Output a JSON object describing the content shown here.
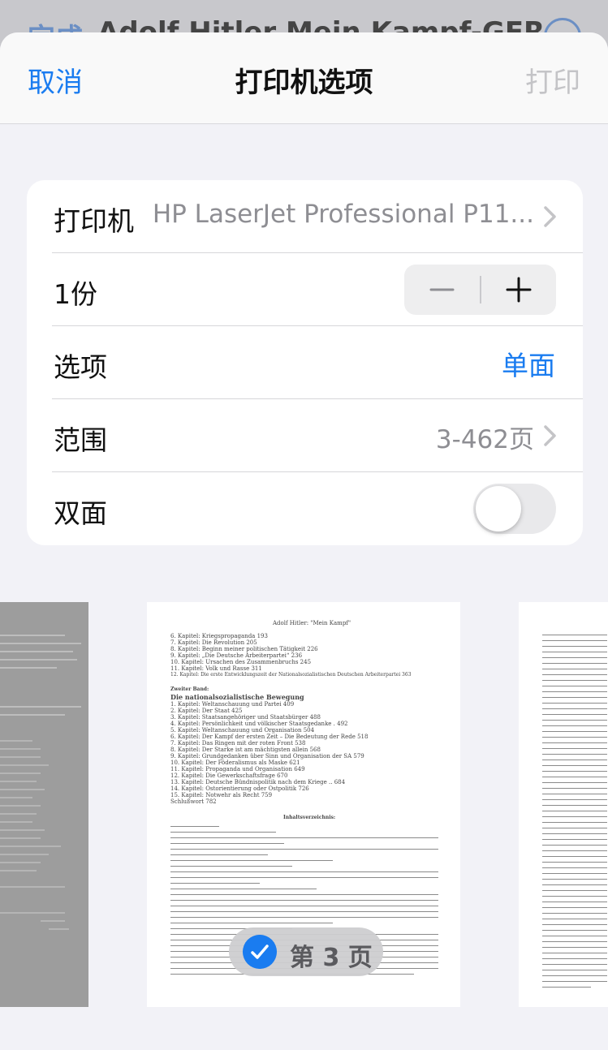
{
  "background": {
    "left_button": "完成",
    "title": "Adolf Hitler Mein Kampf-GER"
  },
  "navbar": {
    "cancel_label": "取消",
    "title": "打印机选项",
    "print_label": "打印"
  },
  "options": {
    "printer": {
      "label": "打印机",
      "value": "HP LaserJet Professional P11..."
    },
    "copies": {
      "label": "1份"
    },
    "options_row": {
      "label": "选项",
      "value": "单面"
    },
    "range": {
      "label": "范围",
      "value": "3-462页"
    },
    "duplex": {
      "label": "双面",
      "on": false
    }
  },
  "preview": {
    "page_label": "第 3 页",
    "main_page": {
      "header": "Adolf Hitler: \"Mein Kampf\"",
      "chapters_1": [
        "6. Kapitel: Kriegspropaganda 193",
        "7. Kapitel: Die Revolution 205",
        "8. Kapitel: Beginn meiner politischen Tätigkeit 226",
        "9. Kapitel: „Die Deutsche Arbeiterpartei“ 236",
        "10. Kapitel: Ursachen des Zusammenbruchs 245",
        "11. Kapitel: Volk und Rasse 311",
        "12. Kapitel: Die erste Entwicklungszeit der Nationalsozialistischen Deutschen Arbeiterpartei 363"
      ],
      "volume_label": "Zweiter Band:",
      "volume_title": "Die nationalsozialistische Bewegung",
      "chapters_2": [
        "1. Kapitel: Weltanschauung und Partei 409",
        "2. Kapitel: Der Staat 425",
        "3. Kapitel: Staatsangehöriger und Staatsbürger 488",
        "4. Kapitel: Persönlichkeit und völkischer Staatsgedanke . 492",
        "5. Kapitel: Weltanschauung und Organisation 504",
        "6. Kapitel: Der Kampf der ersten Zeit – Die Bedeutung der Rede 518",
        "7. Kapitel: Das Ringen mit der roten Front 538",
        "8. Kapitel: Der Starke ist am mächtigsten allein 568",
        "9. Kapitel: Grundgedanken über Sinn und Organisation der SA 579",
        "10. Kapitel: Der Föderalismus als Maske 621",
        "11. Kapitel: Propaganda und Organisation 649",
        "12. Kapitel: Die Gewerkschaftsfrage 670",
        "13. Kapitel: Deutsche Bündnispolitik nach dem Kriege .. 684",
        "14. Kapitel: Ostorientierung oder Ostpolitik 726",
        "15. Kapitel: Notwehr als Recht 759",
        "Schlußwort 782"
      ],
      "index_title": "Inhaltsverzeichnis:"
    }
  }
}
